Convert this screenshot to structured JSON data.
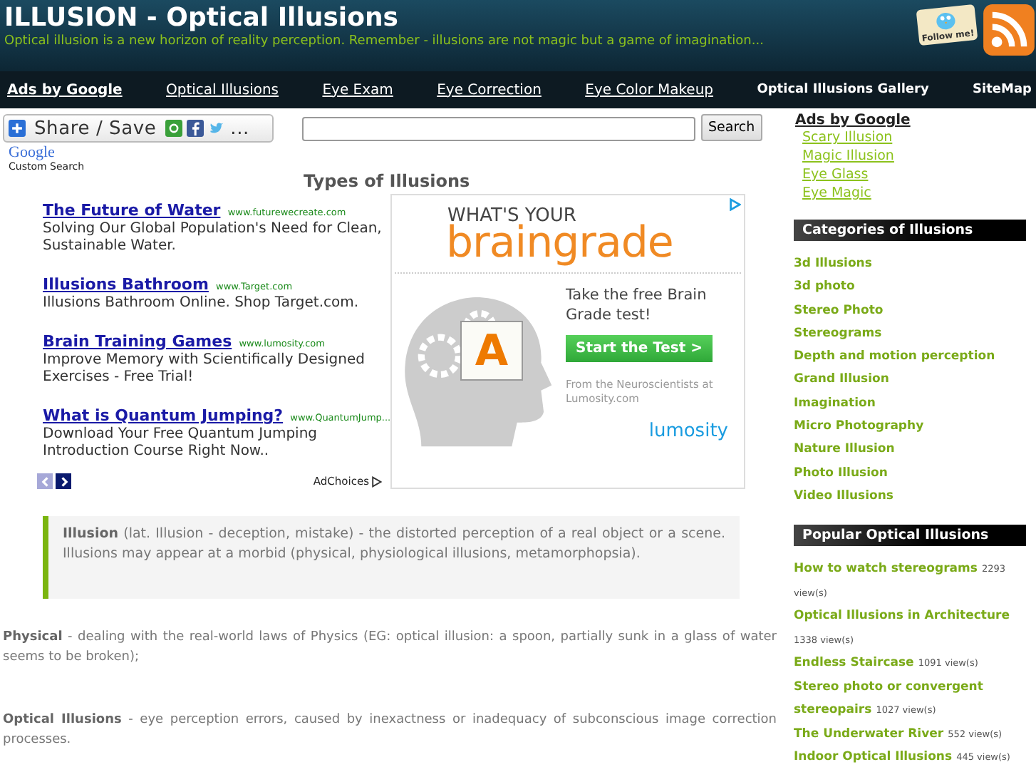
{
  "header": {
    "title": "ILLUSION - Optical Illusions",
    "tagline": "Optical illusion is a new horizon of reality perception. Remember - illusions are not magic but a game of imagination...",
    "follow_badge": "Follow me!"
  },
  "nav": [
    {
      "label": "Ads by Google",
      "kind": "heading"
    },
    {
      "label": "Optical Illusions",
      "kind": "ad"
    },
    {
      "label": "Eye Exam",
      "kind": "ad"
    },
    {
      "label": "Eye Correction",
      "kind": "ad"
    },
    {
      "label": "Eye Color Makeup",
      "kind": "ad"
    },
    {
      "label": "Optical Illusions Gallery",
      "kind": "site"
    },
    {
      "label": "SiteMap",
      "kind": "site"
    }
  ],
  "share": {
    "label": "Share / Save",
    "more": "..."
  },
  "search": {
    "button": "Search",
    "brand": "Google",
    "caption": "Custom Search"
  },
  "section_title": "Types of Illusions",
  "text_ads": [
    {
      "title": "The Future of Water",
      "url": "www.futurewecreate.com",
      "text": "Solving Our Global Population's Need for Clean, Sustainable Water."
    },
    {
      "title": "Illusions Bathroom",
      "url": "www.Target.com",
      "text": "Illusions Bathroom Online. Shop Target.com."
    },
    {
      "title": "Brain Training Games",
      "url": "www.lumosity.com",
      "text": "Improve Memory with Scientifically Designed Exercises - Free Trial!"
    },
    {
      "title": "What is Quantum Jumping?",
      "url": "www.QuantumJump...",
      "text": "Download Your Free Quantum Jumping Introduction Course Right Now.."
    }
  ],
  "pager": [
    {
      "disabled": true
    },
    {
      "disabled": false
    }
  ],
  "adchoices": "AdChoices",
  "banner": {
    "kicker": "WHAT'S YOUR",
    "brand_1": "brain",
    "brand_2": "grade",
    "grade": "A",
    "pitch": "Take the free Brain Grade test!",
    "button": "Start the Test >",
    "source": "From the Neuroscientists at Lumosity.com",
    "logo": "lumosity"
  },
  "quote": "**Illusion** (lat. Illusion - deception, mistake) - the distorted perception of a real object or a scene. Illusions may appear at a morbid (physical, physiological illusions, metamorphopsia).",
  "paragraphs": [
    "**Physical** - dealing with the real-world laws of Physics (EG: optical illusion: a spoon, partially sunk in a glass of water seems to be broken);",
    "**Optical Illusions** - eye perception errors, caused by inexactness or inadequacy of subconscious image correction processes."
  ],
  "sidebar": {
    "ads_heading": "Ads by Google",
    "ad_links": [
      "Scary Illusion",
      "Magic Illusion",
      "Eye Glass",
      "Eye Magic"
    ],
    "categories_title": "Categories of Illusions",
    "categories": [
      "3d Illusions",
      "3d photo",
      "Stereo Photo",
      "Stereograms",
      "Depth and motion perception",
      "Grand Illusion",
      "Imagination",
      "Micro Photography",
      "Nature Illusion",
      "Photo Illusion",
      "Video Illusions"
    ],
    "popular_title": "Popular Optical Illusions",
    "popular": [
      {
        "title": "How to watch stereograms",
        "views": "2293 view(s)"
      },
      {
        "title": "Optical Illusions in Architecture",
        "views": "1338 view(s)"
      },
      {
        "title": "Endless Staircase",
        "views": "1091 view(s)"
      },
      {
        "title": "Stereo photo or convergent stereopairs",
        "views": "1027 view(s)"
      },
      {
        "title": "The Underwater River",
        "views": "552 view(s)"
      },
      {
        "title": "Indoor Optical Illusions",
        "views": "445 view(s)"
      }
    ]
  }
}
